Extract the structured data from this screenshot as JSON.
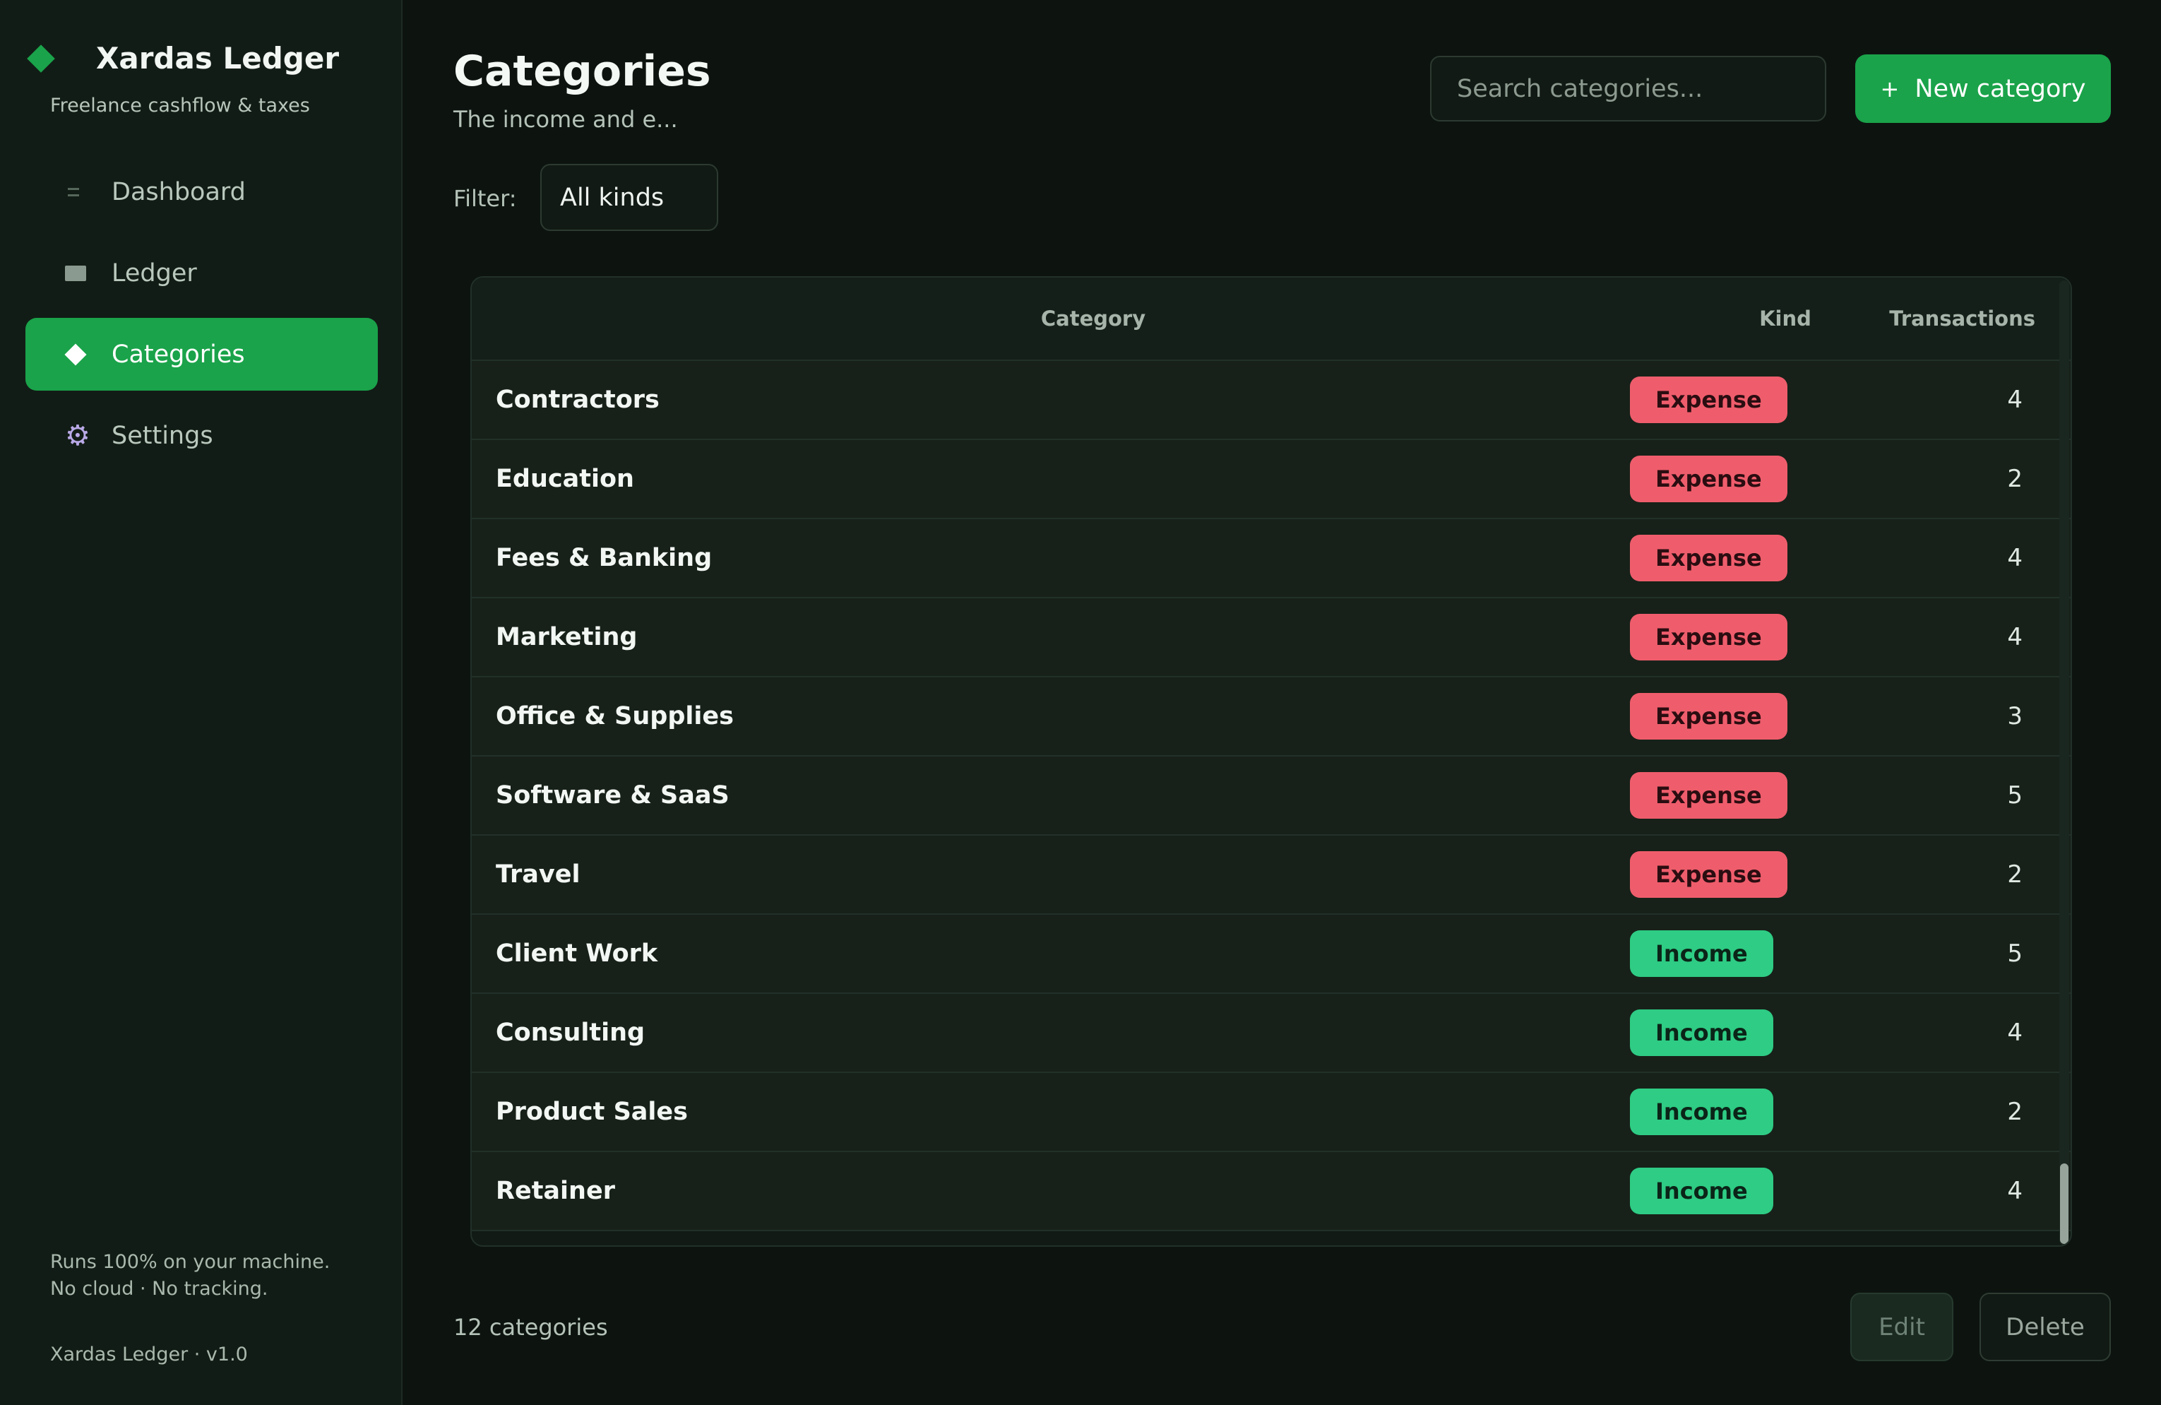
{
  "app": {
    "name": "Xardas Ledger",
    "tagline": "Freelance cashflow & taxes",
    "footer_line1": "Runs 100% on your machine.",
    "footer_line2": "No cloud · No tracking.",
    "version": "Xardas Ledger · v1.0"
  },
  "sidebar": {
    "items": [
      {
        "label": "Dashboard",
        "icon": "dashboard-icon",
        "active": false
      },
      {
        "label": "Ledger",
        "icon": "ledger-icon",
        "active": false
      },
      {
        "label": "Categories",
        "icon": "diamond-icon",
        "active": true
      },
      {
        "label": "Settings",
        "icon": "gear-icon",
        "active": false
      }
    ]
  },
  "header": {
    "title": "Categories",
    "description": "The income and e...",
    "search_placeholder": "Search categories...",
    "new_button_icon": "+",
    "new_button_label": "New category"
  },
  "filter": {
    "label": "Filter:",
    "selected": "All kinds"
  },
  "table": {
    "columns": [
      "Category",
      "Kind",
      "Transactions"
    ],
    "rows": [
      {
        "name": "Contractors",
        "kind": "Expense",
        "count": "4"
      },
      {
        "name": "Education",
        "kind": "Expense",
        "count": "2"
      },
      {
        "name": "Fees & Banking",
        "kind": "Expense",
        "count": "4"
      },
      {
        "name": "Marketing",
        "kind": "Expense",
        "count": "4"
      },
      {
        "name": "Office & Supplies",
        "kind": "Expense",
        "count": "3"
      },
      {
        "name": "Software & SaaS",
        "kind": "Expense",
        "count": "5"
      },
      {
        "name": "Travel",
        "kind": "Expense",
        "count": "2"
      },
      {
        "name": "Client Work",
        "kind": "Income",
        "count": "5"
      },
      {
        "name": "Consulting",
        "kind": "Income",
        "count": "4"
      },
      {
        "name": "Product Sales",
        "kind": "Income",
        "count": "2"
      },
      {
        "name": "Retainer",
        "kind": "Income",
        "count": "4"
      }
    ]
  },
  "footer": {
    "count_text": "12 categories",
    "edit_label": "Edit",
    "delete_label": "Delete"
  },
  "colors": {
    "accent": "#1aa34a",
    "expense": "#ef5d6c",
    "income": "#2ecc84",
    "background": "#0d1410"
  }
}
